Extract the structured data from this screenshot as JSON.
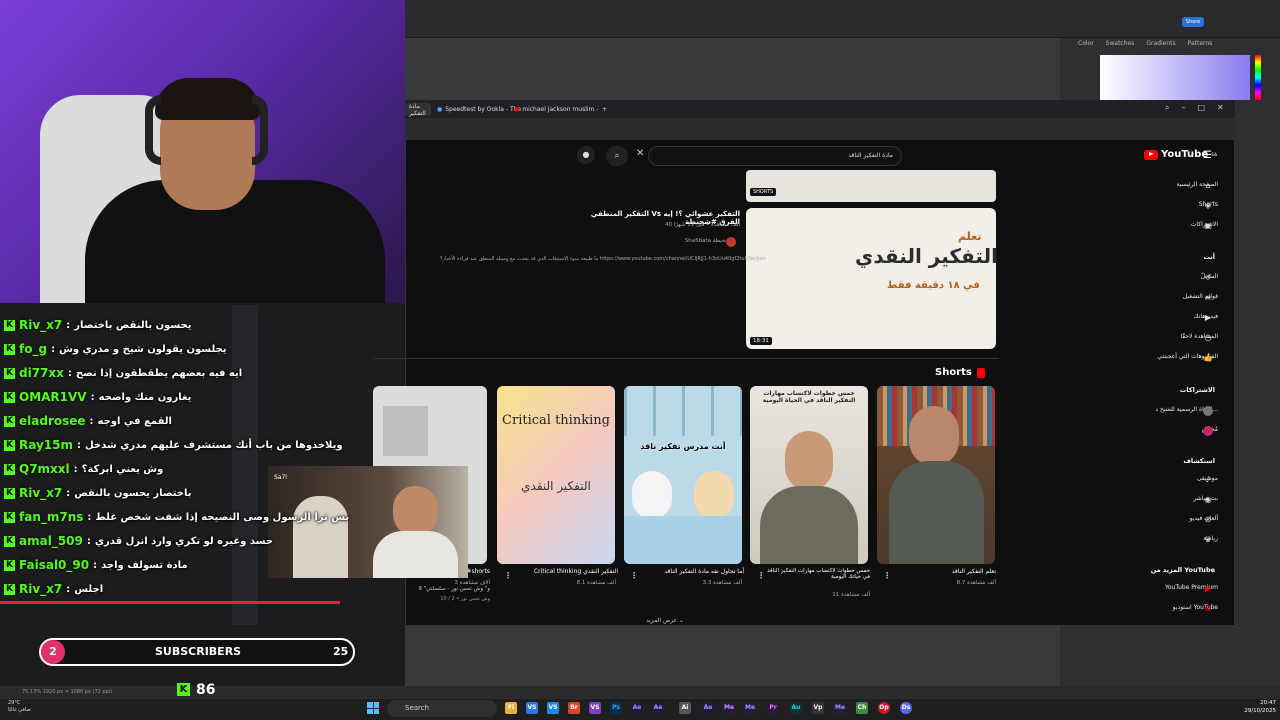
{
  "stream": {
    "chat": [
      {
        "user": "Riv_x7",
        "message": "يحسون بالنقص باختصار"
      },
      {
        "user": "fo_g",
        "message": "يجلسون يقولون شيخ و مدري وش"
      },
      {
        "user": "di77xx",
        "message": "ايه فيه بعضهم يطقطقون إذا نصح"
      },
      {
        "user": "OMAR1VV",
        "message": "يغارون منك واضحه"
      },
      {
        "user": "eladrosee",
        "message": "القمع في اوجه"
      },
      {
        "user": "Ray15m",
        "message": "ويلاخذوها من باب أنك مستشرف عليهم مدري شدخل"
      },
      {
        "user": "Q7mxxl",
        "message": "وش يعني ابركة؟"
      },
      {
        "user": "Riv_x7",
        "message": "باختصار يحسون بالنقص"
      },
      {
        "user": "fan_m7ns",
        "message": "بس ترا الرسول وصى النصيحه إذا شفت شخص غلط"
      },
      {
        "user": "amal_509",
        "message": "حسد وغيره لو تكري وارد انزل قدري"
      },
      {
        "user": "Faisal0_90",
        "message": "مادة تسولف واجد"
      },
      {
        "user": "Riv_x7",
        "message": "اجلس"
      }
    ],
    "subs": {
      "current": "2",
      "label": "SUBSCRIBERS",
      "goal": "25"
    },
    "kick_viewers": "86",
    "kick_icon": "K"
  },
  "photoshop": {
    "panel_tabs": [
      "Color",
      "Swatches",
      "Gradients",
      "Patterns"
    ],
    "share": "Share",
    "status": "75.13%     1920 px × 1080 px (72 ppi)"
  },
  "browser": {
    "tabs": [
      "مادة التفكير",
      "Speedtest by Ookla - The",
      "michael jackson muslim -"
    ],
    "new_tab": "+",
    "window_controls": [
      "search-icon",
      "minimize-icon",
      "maximize-icon",
      "close-icon"
    ]
  },
  "youtube": {
    "logo": "YouTube",
    "country": "SA",
    "search_query": "مادة التفكير الناقد",
    "sidebar": {
      "main": [
        {
          "label": "الصفحة الرئيسية",
          "icon": "home-icon"
        },
        {
          "label": "Shorts",
          "icon": "shorts-icon"
        },
        {
          "label": "الاشتراكات",
          "icon": "subscriptions-icon"
        }
      ],
      "you_header": "أنت",
      "you": [
        {
          "label": "السجلّ",
          "icon": "history-icon"
        },
        {
          "label": "قوائم التشغيل",
          "icon": "playlist-icon"
        },
        {
          "label": "فيديوهاتك",
          "icon": "video-icon"
        },
        {
          "label": "المشاهدة لاحقًا",
          "icon": "clock-icon"
        },
        {
          "label": "الفيديوهات التي أعجبتني",
          "icon": "like-icon"
        }
      ],
      "subs_header": "الاشتراكات",
      "subs": [
        {
          "label": "القناة الرسمية للشيخ د...",
          "icon": "channel-avatar-icon"
        },
        {
          "label": "مُخلص",
          "icon": "channel-avatar-icon"
        }
      ],
      "explore_header": "استكشاف",
      "explore": [
        {
          "label": "موسيقى",
          "icon": "music-icon"
        },
        {
          "label": "بث مباشر",
          "icon": "live-icon"
        },
        {
          "label": "ألعاب فيديو",
          "icon": "gaming-icon"
        },
        {
          "label": "رياضة",
          "icon": "trophy-icon"
        }
      ],
      "more_header": "المزيد من YouTube",
      "more": [
        {
          "label": "YouTube Premium",
          "icon": "yt-premium-icon"
        },
        {
          "label": "استوديو YouTube",
          "icon": "yt-studio-icon"
        }
      ]
    },
    "top_thumb_badge": "SHORTS",
    "video": {
      "title": "التفكير المنطقي Vs التفكير عشوائي ؟! إيه الفرق #شحبطة",
      "meta": "40 ألف مشاهدة • قبل 11 شهرًا",
      "channel": "Sha5bata شخبطة",
      "description": "ما طبيعة سوء الاستيعاب الذي قد يحدث مع وسيلة المنطق عند قراءة الأخبار؟ https://www.youtube.com/channel/UCIjRjJ1-h3oUu40gf2tuh3w/join",
      "thumb_learn": "تعلم",
      "thumb_main": "التفكير النقدي",
      "thumb_time": "في ١٨ دقيقة فقط",
      "duration": "18:31"
    },
    "shorts_header": "Shorts",
    "shorts": [
      {
        "title": "تعلم التفكير الناقد",
        "views": "8.7 ألف مشاهدة",
        "thumb_text": ""
      },
      {
        "title": "خمس خطوات لاكتساب مهارات التفكير الناقد في حياتك اليومية",
        "views": "11 ألف مشاهدة",
        "thumb_text": "خمس خطوات لاكتساب مهارات التفكير الناقد في الحياة اليومية"
      },
      {
        "title": "أما تحاول تفه مادة التفكير الناقد",
        "views": "3.3 ألف مشاهدة",
        "thumb_text": "أنت مدرس تفكير ناقد"
      },
      {
        "title": "Critical thinking التفكير النقدي",
        "views": "8.1 ألف مشاهدة",
        "thumb_text": "Critical thinking",
        "thumb_text2": "التفكير النقدي"
      },
      {
        "title": "ملخص التفكير الناقد #shorts",
        "views": "3 آلاف مشاهدة",
        "thumb_text": ""
      }
    ],
    "show_more": "عرض المزيد"
  },
  "overlay_clip": {
    "logo": "Sa7l",
    "caption": "9 \"و\" وش تحس نور - سلسلتي",
    "meta": "وش تحس نور • 2 / 10"
  },
  "taskbar": {
    "weather_temp": "29°C",
    "weather_desc": "صافي غالبًا",
    "search": "Search",
    "time": "20:47",
    "date": "29/10/2025",
    "apps": [
      "Fi",
      "VS",
      "Br",
      "VS",
      "Ps",
      "Ae",
      "Ae",
      "Ai",
      "Me",
      "Pr",
      "Au",
      "Vp",
      "Me",
      "Ch",
      "Op",
      "Ds"
    ]
  }
}
